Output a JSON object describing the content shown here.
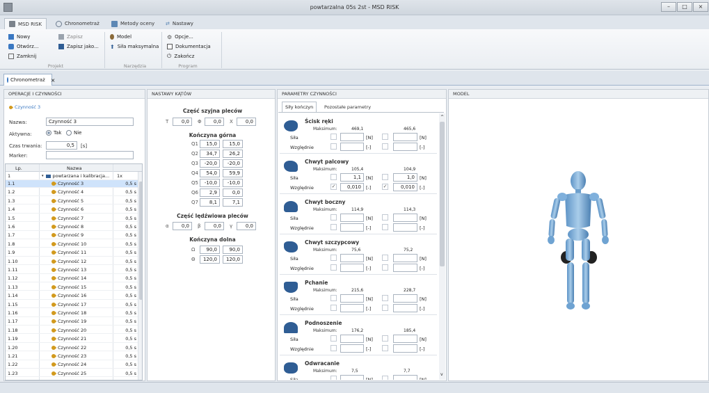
{
  "window": {
    "title": "powtarzalna 05s 2st - MSD RISK",
    "minimize": "–",
    "maximize": "□",
    "close": "×"
  },
  "menu_tabs": [
    {
      "label": "MSD RISK",
      "icon": "app-icon"
    },
    {
      "label": "Chronometraż",
      "icon": "clock-icon"
    },
    {
      "label": "Metody oceny",
      "icon": "chart-icon"
    },
    {
      "label": "Nastawy",
      "icon": "arrows-icon"
    }
  ],
  "ribbon": {
    "projekt": {
      "group": "Projekt",
      "nowy": "Nowy",
      "otworz": "Otwórz...",
      "zamknij": "Zamknij",
      "zapisz": "Zapisz",
      "zapisz_jako": "Zapisz jako..."
    },
    "narzedzia": {
      "group": "Narzędzia",
      "model": "Model",
      "sila": "Siła maksymalna"
    },
    "program": {
      "group": "Program",
      "opcje": "Opcje...",
      "dokumentacja": "Dokumentacja",
      "zakoncz": "Zakończ"
    }
  },
  "doc_tab": {
    "label": "Chronometraż",
    "close": "×"
  },
  "operacje": {
    "header": "OPERACJE I CZYNNOŚCI",
    "breadcrumb": "Czynność 3",
    "nazwa_label": "Nazwa:",
    "nazwa_value": "Czynność 3",
    "aktywna_label": "Aktywna:",
    "tak": "Tak",
    "nie": "Nie",
    "czas_label": "Czas trwania:",
    "czas_value": "0,5",
    "czas_unit": "[s]",
    "marker_label": "Marker:",
    "marker_value": "",
    "col_lp": "Lp.",
    "col_nazwa": "Nazwa",
    "group_row": {
      "lp": "1",
      "name": "powtarzana i kalibracja...",
      "rep": "1x"
    },
    "rows": [
      {
        "lp": "1.1",
        "name": "Czynność 3",
        "t": "0,5 s"
      },
      {
        "lp": "1.2",
        "name": "Czynność 4",
        "t": "0,5 s"
      },
      {
        "lp": "1.3",
        "name": "Czynność 5",
        "t": "0,5 s"
      },
      {
        "lp": "1.4",
        "name": "Czynność 6",
        "t": "0,5 s"
      },
      {
        "lp": "1.5",
        "name": "Czynność 7",
        "t": "0,5 s"
      },
      {
        "lp": "1.6",
        "name": "Czynność 8",
        "t": "0,5 s"
      },
      {
        "lp": "1.7",
        "name": "Czynność 9",
        "t": "0,5 s"
      },
      {
        "lp": "1.8",
        "name": "Czynność 10",
        "t": "0,5 s"
      },
      {
        "lp": "1.9",
        "name": "Czynność 11",
        "t": "0,5 s"
      },
      {
        "lp": "1.10",
        "name": "Czynność 12",
        "t": "0,5 s"
      },
      {
        "lp": "1.11",
        "name": "Czynność 13",
        "t": "0,5 s"
      },
      {
        "lp": "1.12",
        "name": "Czynność 14",
        "t": "0,5 s"
      },
      {
        "lp": "1.13",
        "name": "Czynność 15",
        "t": "0,5 s"
      },
      {
        "lp": "1.14",
        "name": "Czynność 16",
        "t": "0,5 s"
      },
      {
        "lp": "1.15",
        "name": "Czynność 17",
        "t": "0,5 s"
      },
      {
        "lp": "1.16",
        "name": "Czynność 18",
        "t": "0,5 s"
      },
      {
        "lp": "1.17",
        "name": "Czynność 19",
        "t": "0,5 s"
      },
      {
        "lp": "1.18",
        "name": "Czynność 20",
        "t": "0,5 s"
      },
      {
        "lp": "1.19",
        "name": "Czynność 21",
        "t": "0,5 s"
      },
      {
        "lp": "1.20",
        "name": "Czynność 22",
        "t": "0,5 s"
      },
      {
        "lp": "1.21",
        "name": "Czynność 23",
        "t": "0,5 s"
      },
      {
        "lp": "1.22",
        "name": "Czynność 24",
        "t": "0,5 s"
      },
      {
        "lp": "1.23",
        "name": "Czynność 25",
        "t": "0,5 s"
      }
    ]
  },
  "nastawy": {
    "header": "NASTAWY KĄTÓW",
    "szyja_title": "Część szyjna pleców",
    "szyja": [
      {
        "k": "T",
        "v": "0,0"
      },
      {
        "k": "Φ",
        "v": "0,0"
      },
      {
        "k": "X",
        "v": "0,0"
      }
    ],
    "gorna_title": "Kończyna górna",
    "gorna": [
      {
        "k": "Q1",
        "l": "15,0",
        "r": "15,0"
      },
      {
        "k": "Q2",
        "l": "34,7",
        "r": "26,2"
      },
      {
        "k": "Q3",
        "l": "-20,0",
        "r": "-20,0"
      },
      {
        "k": "Q4",
        "l": "54,0",
        "r": "59,9"
      },
      {
        "k": "Q5",
        "l": "-10,0",
        "r": "-10,0"
      },
      {
        "k": "Q6",
        "l": "2,9",
        "r": "0,0"
      },
      {
        "k": "Q7",
        "l": "8,1",
        "r": "7,1"
      }
    ],
    "ledzwie_title": "Część lędźwiowa pleców",
    "ledzwie": [
      {
        "k": "α",
        "v": "0,0"
      },
      {
        "k": "β",
        "v": "0,0"
      },
      {
        "k": "γ",
        "v": "0,0"
      }
    ],
    "dolna_title": "Kończyna dolna",
    "dolna": [
      {
        "k": "Ω",
        "l": "90,0",
        "r": "90,0"
      },
      {
        "k": "Θ",
        "l": "120,0",
        "r": "120,0"
      }
    ]
  },
  "parametry": {
    "header": "PARAMETRY CZYNNOŚCI",
    "tab1": "Siły kończyn",
    "tab2": "Pozostałe parametry",
    "max_label": "Maksimum:",
    "sila_label": "Siła",
    "wzgl_label": "Względnie",
    "unit_n": "[N]",
    "unit_rel": "[-]",
    "limbs": [
      {
        "title": "Ścisk ręki",
        "maxL": "469,1",
        "maxR": "465,6",
        "silaL": "",
        "silaR": "",
        "wzL": "",
        "wzR": "",
        "checked": false
      },
      {
        "title": "Chwyt palcowy",
        "maxL": "105,4",
        "maxR": "104,9",
        "silaL": "1,1",
        "silaR": "1,0",
        "wzL": "0,010",
        "wzR": "0,010",
        "checked": true
      },
      {
        "title": "Chwyt boczny",
        "maxL": "114,9",
        "maxR": "114,3",
        "silaL": "",
        "silaR": "",
        "wzL": "",
        "wzR": "",
        "checked": false
      },
      {
        "title": "Chwyt szczypcowy",
        "maxL": "75,6",
        "maxR": "75,2",
        "silaL": "",
        "silaR": "",
        "wzL": "",
        "wzR": "",
        "checked": false
      },
      {
        "title": "Pchanie",
        "maxL": "215,6",
        "maxR": "228,7",
        "silaL": "",
        "silaR": "",
        "wzL": "",
        "wzR": "",
        "checked": false
      },
      {
        "title": "Podnoszenie",
        "maxL": "176,2",
        "maxR": "185,4",
        "silaL": "",
        "silaR": "",
        "wzL": "",
        "wzR": "",
        "checked": false
      },
      {
        "title": "Odwracanie",
        "maxL": "7,5",
        "maxR": "7,7",
        "silaL": "",
        "silaR": "",
        "wzL": "",
        "wzR": "",
        "checked": false
      }
    ]
  },
  "model": {
    "header": "MODEL"
  }
}
